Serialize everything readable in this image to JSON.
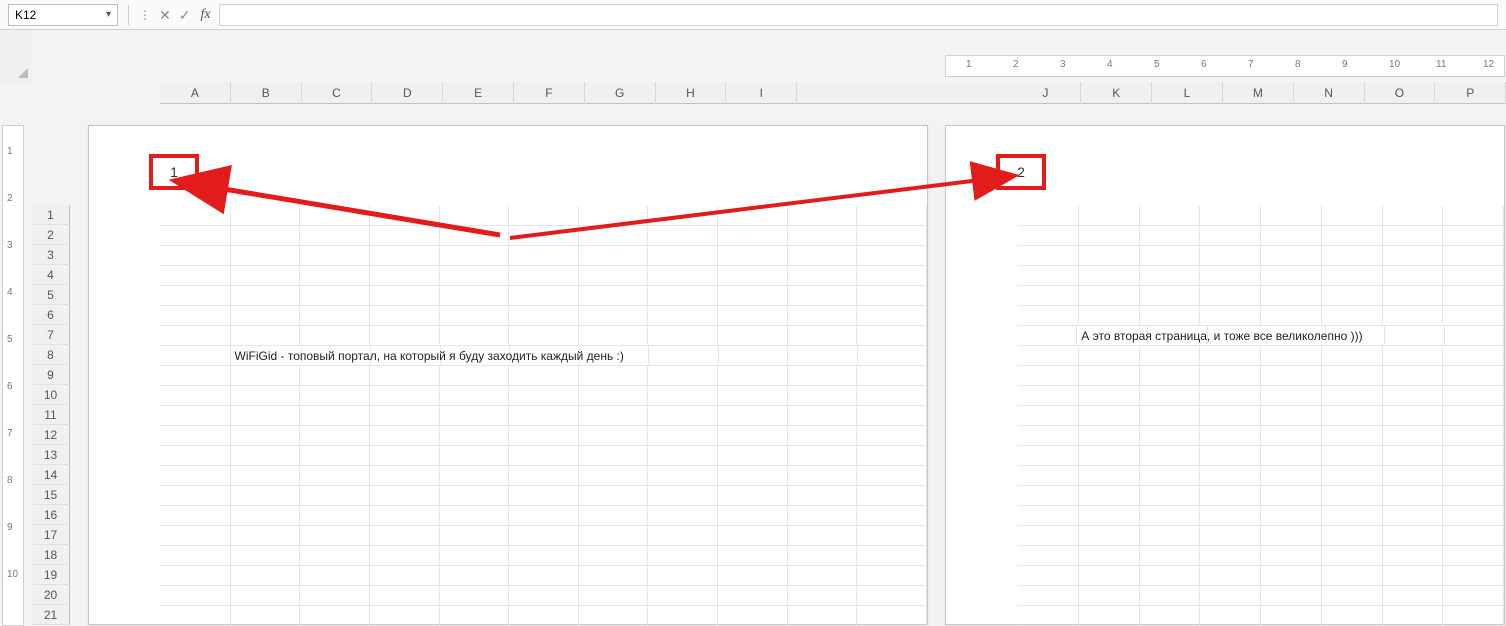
{
  "formula_bar": {
    "cell_reference": "K12",
    "fx_label": "fx",
    "formula_value": ""
  },
  "columns_page1": [
    "A",
    "B",
    "C",
    "D",
    "E",
    "F",
    "G",
    "H",
    "I"
  ],
  "columns_page2": [
    "J",
    "K",
    "L",
    "M",
    "N",
    "O",
    "P"
  ],
  "rows": [
    "1",
    "2",
    "3",
    "4",
    "5",
    "6",
    "7",
    "8",
    "9",
    "10",
    "11",
    "12",
    "13",
    "14",
    "15",
    "16",
    "17",
    "18",
    "19",
    "20",
    "21"
  ],
  "ruler_ticks_h": [
    "1",
    "2",
    "3",
    "4",
    "5",
    "6",
    "7",
    "8",
    "9",
    "10",
    "11",
    "12"
  ],
  "ruler_ticks_v": [
    "1",
    "2",
    "3",
    "4",
    "5",
    "6",
    "7",
    "8",
    "9",
    "10"
  ],
  "page1": {
    "number": "1",
    "content_cell": "WiFiGid - топовый портал, на который я буду заходить каждый день :)"
  },
  "page2": {
    "number": "2",
    "content_cell": "А это вторая страница, и тоже все великолепно )))"
  },
  "annotation": {
    "color": "#e21b1b"
  }
}
